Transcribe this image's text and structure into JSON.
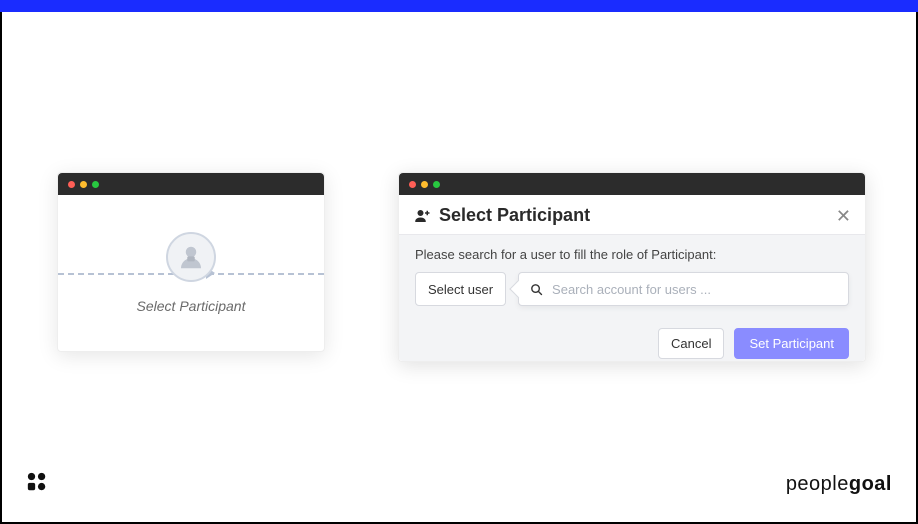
{
  "flowCard": {
    "label": "Select Participant"
  },
  "modal": {
    "title": "Select Participant",
    "instruction": "Please search for a user to fill the role of Participant:",
    "selectUserButton": "Select user",
    "searchPlaceholder": "Search account for users ...",
    "cancelButton": "Cancel",
    "submitButton": "Set Participant"
  },
  "brand": {
    "part1": "people",
    "part2": "goal"
  }
}
